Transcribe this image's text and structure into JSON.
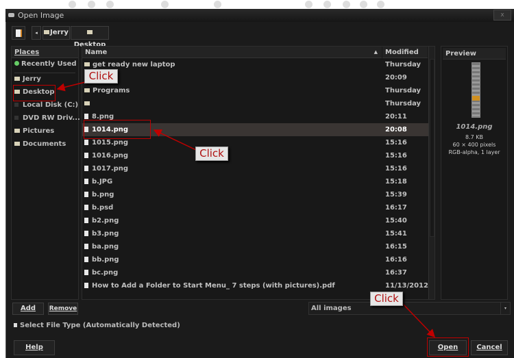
{
  "window": {
    "title": "Open Image",
    "close_label": "x"
  },
  "path_bar": {
    "segments": [
      "Jerry",
      "Desktop"
    ]
  },
  "places": {
    "header": "Places",
    "items": [
      {
        "label": "Recently Used",
        "icon": "clock-icon"
      },
      {
        "label": "Jerry",
        "icon": "folder-icon"
      },
      {
        "label": "Desktop",
        "icon": "folder-icon"
      },
      {
        "label": "Local Disk (C:)",
        "icon": "drive-icon"
      },
      {
        "label": "DVD RW Driv...",
        "icon": "dvd-icon"
      },
      {
        "label": "Pictures",
        "icon": "folder-icon"
      },
      {
        "label": "Documents",
        "icon": "folder-icon"
      }
    ]
  },
  "files": {
    "col_name": "Name",
    "col_modified": "Modified",
    "rows": [
      {
        "name": "get ready new laptop",
        "modified": "Thursday",
        "type": "folder"
      },
      {
        "name": "der",
        "modified": "20:09",
        "type": "folder"
      },
      {
        "name": "Programs",
        "modified": "Thursday",
        "type": "folder"
      },
      {
        "name": "",
        "modified": "Thursday",
        "type": "folder"
      },
      {
        "name": "8.png",
        "modified": "20:11",
        "type": "file"
      },
      {
        "name": "1014.png",
        "modified": "20:08",
        "type": "file",
        "selected": true
      },
      {
        "name": "1015.png",
        "modified": "15:16",
        "type": "file"
      },
      {
        "name": "1016.png",
        "modified": "15:16",
        "type": "file"
      },
      {
        "name": "1017.png",
        "modified": "15:16",
        "type": "file"
      },
      {
        "name": "b.JPG",
        "modified": "15:18",
        "type": "file"
      },
      {
        "name": "b.png",
        "modified": "15:39",
        "type": "file"
      },
      {
        "name": "b.psd",
        "modified": "16:17",
        "type": "file"
      },
      {
        "name": "b2.png",
        "modified": "15:40",
        "type": "file"
      },
      {
        "name": "b3.png",
        "modified": "15:41",
        "type": "file"
      },
      {
        "name": "ba.png",
        "modified": "16:15",
        "type": "file"
      },
      {
        "name": "bb.png",
        "modified": "16:16",
        "type": "file"
      },
      {
        "name": "bc.png",
        "modified": "16:37",
        "type": "file"
      },
      {
        "name": "How to Add a Folder to Start Menu_ 7 steps (with pictures).pdf",
        "modified": "11/13/2012",
        "type": "file"
      }
    ]
  },
  "preview": {
    "header": "Preview",
    "filename": "1014.png",
    "size": "8.7 KB",
    "dimensions": "60 × 400 pixels",
    "mode": "RGB-alpha, 1 layer"
  },
  "buttons": {
    "add": "Add",
    "remove": "Remove",
    "help": "Help",
    "open": "Open",
    "cancel": "Cancel"
  },
  "filter": {
    "selected": "All images"
  },
  "file_type": {
    "label": "Select File Type (Automatically Detected)"
  },
  "annotations": {
    "callout1": "Click",
    "callout2": "Click",
    "callout3": "Click",
    "color": "#c00000"
  }
}
